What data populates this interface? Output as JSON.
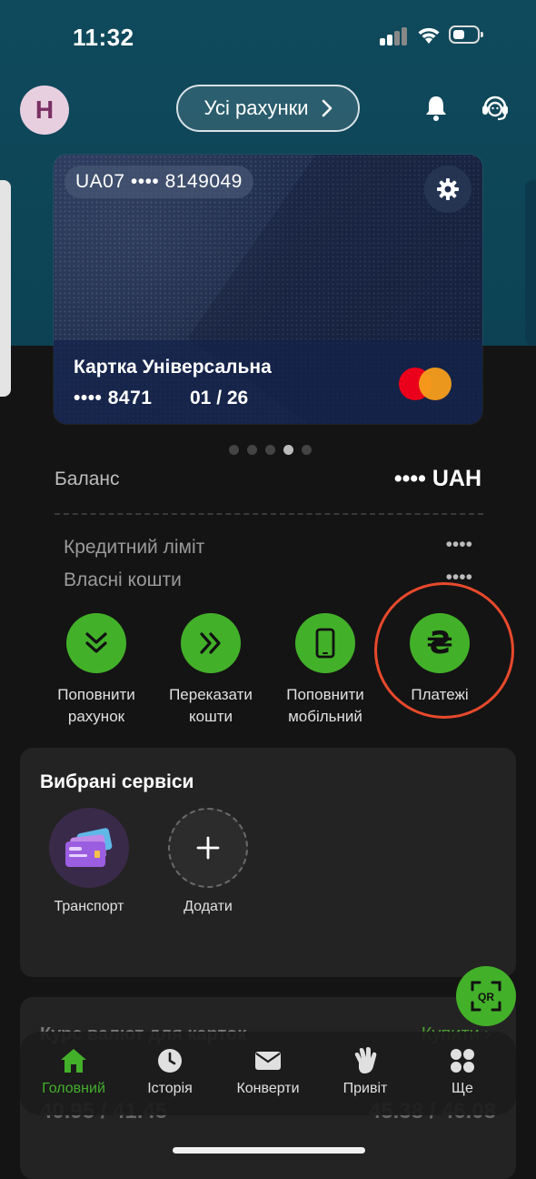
{
  "status_bar": {
    "time": "11:32"
  },
  "header": {
    "avatar_letter": "Н",
    "accounts_label": "Усі рахунки"
  },
  "card": {
    "iban": "UA07 •••• 8149049",
    "name": "Картка Універсальна",
    "number": "•••• 8471",
    "expiry": "01 / 26",
    "brand_icon": "mastercard-logo"
  },
  "pager": {
    "count": 5,
    "active_index": 3
  },
  "balance": {
    "label": "Баланс",
    "value": "•••• UAH",
    "credit_label": "Кредитний ліміт",
    "credit_value": "••••",
    "own_label": "Власні кошти",
    "own_value": "••••"
  },
  "actions": [
    {
      "label_line1": "Поповнити",
      "label_line2": "рахунок",
      "icon": "double-chevron-down-icon"
    },
    {
      "label_line1": "Переказати",
      "label_line2": "кошти",
      "icon": "double-chevron-right-icon"
    },
    {
      "label_line1": "Поповнити",
      "label_line2": "мобільний",
      "icon": "phone-icon"
    },
    {
      "label_line1": "Платежі",
      "label_line2": "",
      "icon": "hryvnia-icon",
      "glyph": "₴"
    }
  ],
  "services": {
    "title": "Вибрані сервіси",
    "items": [
      {
        "label": "Транспорт",
        "icon": "transport-tickets-icon"
      },
      {
        "label": "Додати",
        "icon": "plus-icon"
      }
    ]
  },
  "rates": {
    "title": "Курс валют для карток",
    "link": "Купити",
    "usd": "40.95 / 41.45",
    "eur": "45.38 / 46.08"
  },
  "tabbar": {
    "items": [
      {
        "label": "Головний",
        "icon": "home-icon",
        "active": true
      },
      {
        "label": "Історія",
        "icon": "clock-icon",
        "active": false
      },
      {
        "label": "Конверти",
        "icon": "envelope-icon",
        "active": false
      },
      {
        "label": "Привіт",
        "icon": "hand-wave-icon",
        "active": false
      },
      {
        "label": "Ще",
        "icon": "more-grid-icon",
        "active": false
      }
    ]
  },
  "qr_button": {
    "label": "QR"
  },
  "colors": {
    "accent_green": "#43b02a",
    "header_teal": "#0f4a5c",
    "highlight_ring": "#e9492c"
  }
}
